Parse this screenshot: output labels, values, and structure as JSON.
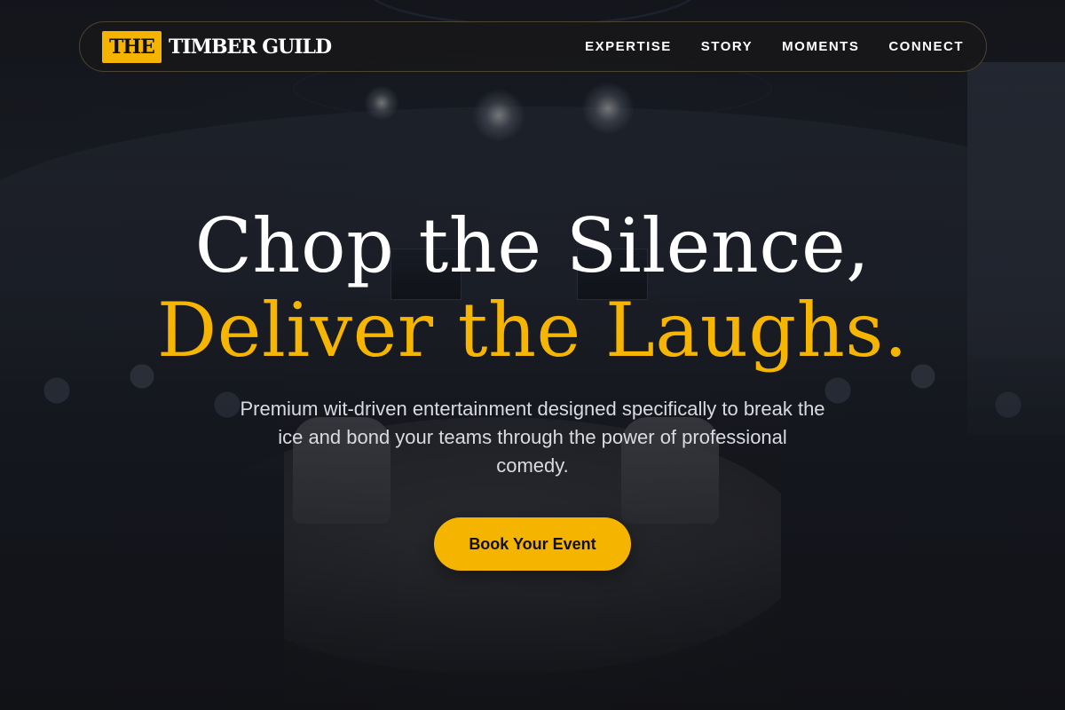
{
  "brand": {
    "badge": "THE",
    "name": "TIMBER GUILD",
    "accent_color": "#f5b400"
  },
  "nav": {
    "items": [
      {
        "label": "EXPERTISE"
      },
      {
        "label": "STORY"
      },
      {
        "label": "MOMENTS"
      },
      {
        "label": "CONNECT"
      }
    ]
  },
  "hero": {
    "title_line1": "Chop the Silence,",
    "title_line2": "Deliver the Laughs.",
    "subtitle": "Premium wit-driven entertainment designed specifically to break the ice and bond your teams through the power of professional comedy.",
    "cta_label": "Book Your Event"
  }
}
